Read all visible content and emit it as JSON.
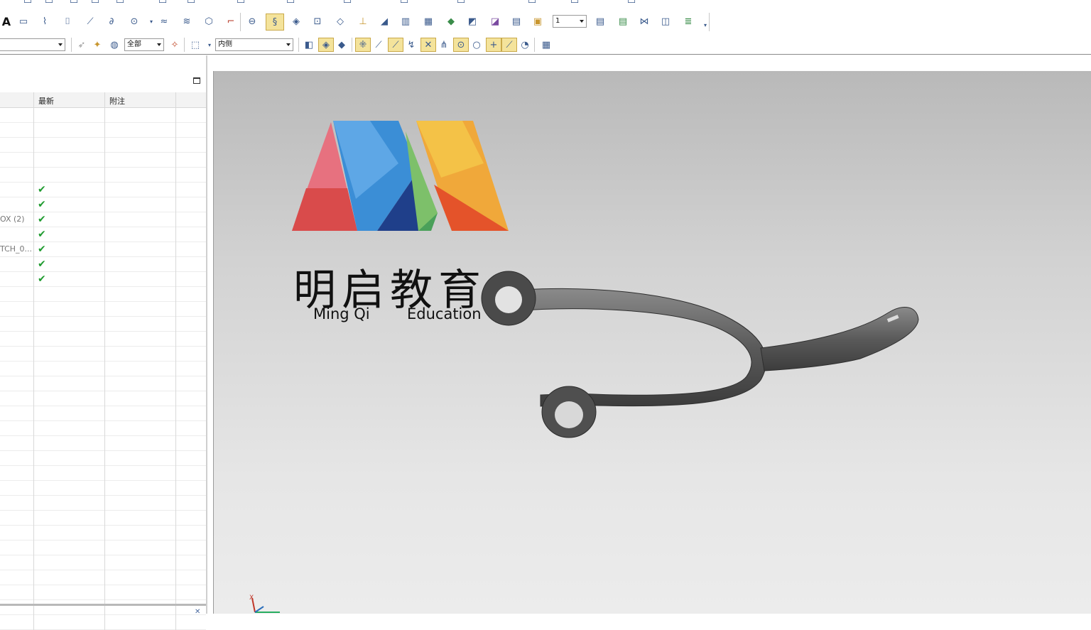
{
  "toolbar2": {
    "layer_value": "1"
  },
  "selection_bar": {
    "filter_value": "",
    "scope_value": "全部",
    "face_rule_value": "内侧"
  },
  "navigator": {
    "columns": [
      "最新",
      "附注"
    ],
    "rows": [
      {
        "name": "",
        "latest": false
      },
      {
        "name": "",
        "latest": false
      },
      {
        "name": "",
        "latest": false
      },
      {
        "name": "",
        "latest": false
      },
      {
        "name": "",
        "latest": false
      },
      {
        "name": "",
        "latest": true
      },
      {
        "name": "",
        "latest": true
      },
      {
        "name": "OX (2)",
        "latest": true
      },
      {
        "name": "",
        "latest": true
      },
      {
        "name": "TCH_0...",
        "latest": true
      },
      {
        "name": "",
        "latest": true
      },
      {
        "name": "",
        "latest": true
      },
      {
        "name": "",
        "latest": false
      },
      {
        "name": "",
        "latest": false
      },
      {
        "name": "",
        "latest": false
      },
      {
        "name": "",
        "latest": false
      },
      {
        "name": "",
        "latest": false
      },
      {
        "name": "",
        "latest": false
      },
      {
        "name": "",
        "latest": false
      },
      {
        "name": "",
        "latest": false
      },
      {
        "name": "",
        "latest": false
      },
      {
        "name": "",
        "latest": false
      },
      {
        "name": "",
        "latest": false
      },
      {
        "name": "",
        "latest": false
      },
      {
        "name": "",
        "latest": false
      },
      {
        "name": "",
        "latest": false
      },
      {
        "name": "",
        "latest": false
      },
      {
        "name": "",
        "latest": false
      },
      {
        "name": "",
        "latest": false
      },
      {
        "name": "",
        "latest": false
      },
      {
        "name": "",
        "latest": false
      },
      {
        "name": "",
        "latest": false
      },
      {
        "name": "",
        "latest": false
      },
      {
        "name": "",
        "latest": false
      },
      {
        "name": "",
        "latest": false
      }
    ],
    "check_glyph": "✔"
  },
  "watermark": {
    "brand_cn": "明启教育",
    "brand_en_1": "Ming Qi",
    "brand_en_2": "Education"
  },
  "viewport": {
    "triad_axis_label": "X"
  },
  "colors": {
    "check_green": "#1e9b2e",
    "active_tool_bg": "#f4e39b",
    "part_gray": "#5a5a5a"
  }
}
